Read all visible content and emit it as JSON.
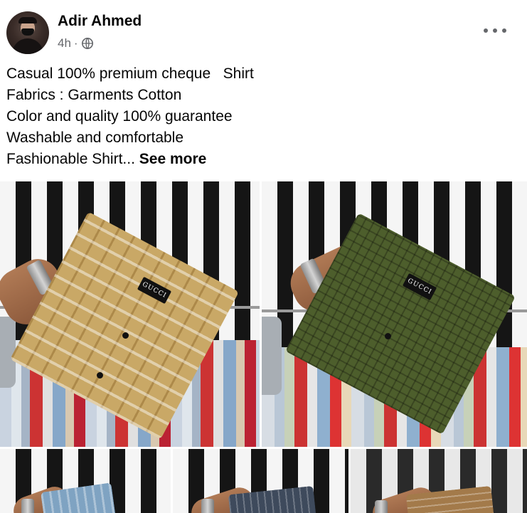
{
  "post": {
    "author": "Adir Ahmed",
    "time": "4h",
    "separator": "·",
    "privacy_icon": "globe-icon",
    "menu_icon": "more-horizontal-icon",
    "text_lines": [
      "Casual 100% premium cheque   Shirt",
      "Fabrics : Garments Cotton",
      "Color and quality 100% guarantee",
      "Washable and comfortable",
      "Fashionable Shirt..."
    ],
    "see_more": "See more"
  },
  "photos": [
    {
      "label": "GUCCI",
      "shirt_color": "#c9a866"
    },
    {
      "label": "GUCCI",
      "shirt_color": "#4d5e2c"
    },
    {
      "label": "",
      "shirt_color": "#7fa3c2"
    },
    {
      "label": "",
      "shirt_color": "#3e4a5c"
    },
    {
      "label": "",
      "shirt_color": "#a37a4a"
    }
  ],
  "colors": {
    "text": "#050505",
    "secondary": "#65676b"
  }
}
